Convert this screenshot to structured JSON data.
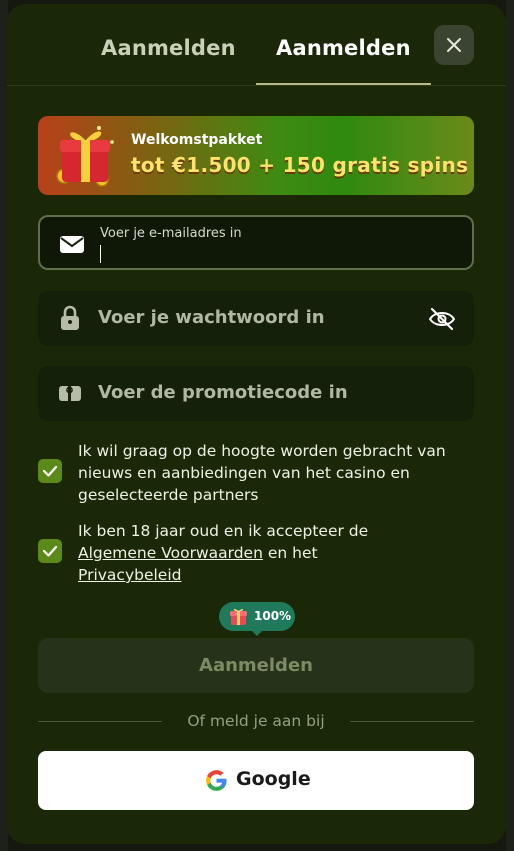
{
  "tabs": {
    "signin_label": "Aanmelden",
    "register_label": "Aanmelden",
    "active": "register"
  },
  "banner": {
    "title": "Welkomstpakket",
    "offer": "tot €1.500 + 150 gratis spins"
  },
  "form": {
    "email": {
      "label": "Voer je e-mailadres in",
      "value": ""
    },
    "password": {
      "placeholder": "Voer je wachtwoord in"
    },
    "promo": {
      "placeholder": "Voer de promotiecode in"
    }
  },
  "consents": [
    {
      "checked": true,
      "text": "Ik wil graag op de hoogte worden gebracht van nieuws en aanbiedingen van het casino en geselecteerde partners"
    },
    {
      "checked": true,
      "text_before": "Ik ben 18 jaar oud en ik accepteer de",
      "link_terms": "Algemene Voorwaarden",
      "text_middle": "en het",
      "link_privacy": "Privacybeleid"
    }
  ],
  "progress": {
    "value": "100%"
  },
  "submit_label": "Aanmelden",
  "or_text": "Of meld je aan bij",
  "google_label": "Google",
  "colors": {
    "accent": "#5b8a1a",
    "modal_bg": "#1a2808",
    "offer": "#fde36b",
    "pill": "#1e7a5a"
  }
}
